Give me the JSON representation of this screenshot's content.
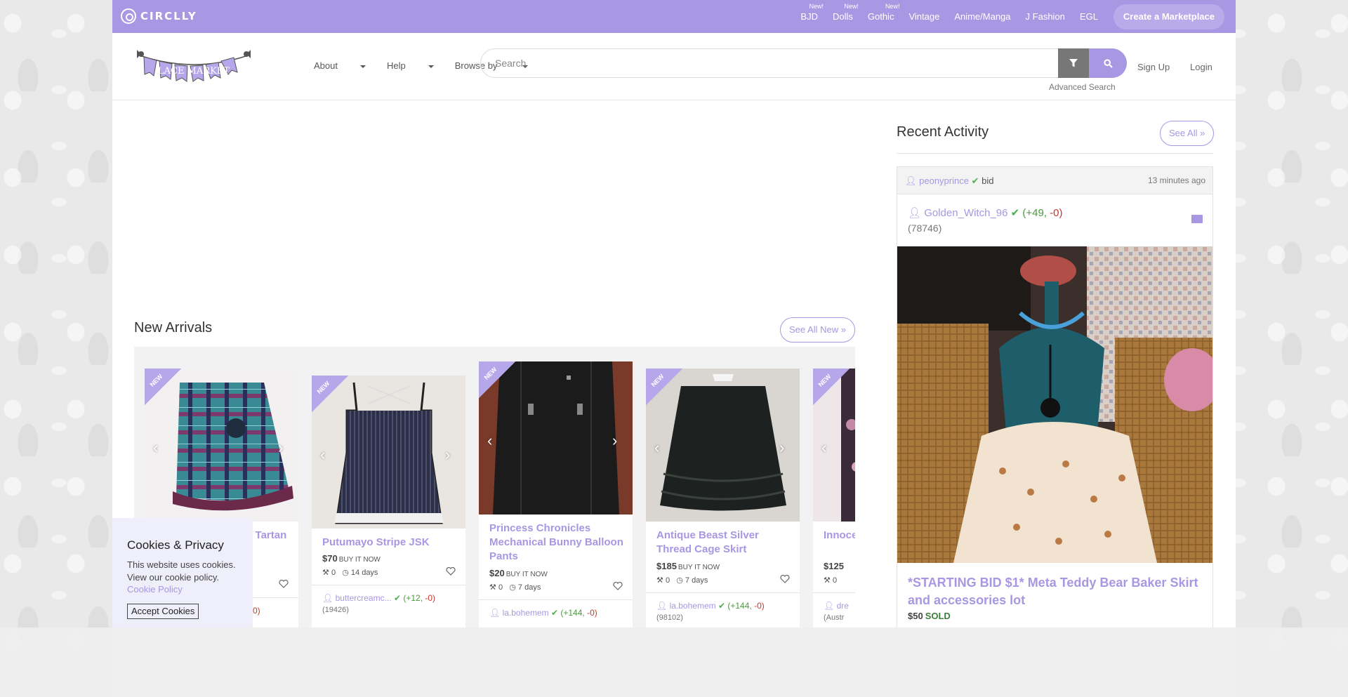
{
  "topbar": {
    "logo": "CIRCLLY",
    "items": [
      {
        "label": "BJD",
        "new": "New!"
      },
      {
        "label": "Dolls",
        "new": "New!"
      },
      {
        "label": "Gothic",
        "new": "New!"
      },
      {
        "label": "Vintage"
      },
      {
        "label": "Anime/Manga"
      },
      {
        "label": "J Fashion"
      },
      {
        "label": "EGL"
      }
    ],
    "cta": "Create a Marketplace"
  },
  "header": {
    "logo_text": "LACE MARKET",
    "nav": {
      "about": "About",
      "help": "Help",
      "browse": "Browse by"
    },
    "search_placeholder": "Search",
    "advanced": "Advanced Search",
    "signup": "Sign Up",
    "login": "Login"
  },
  "new_arrivals": {
    "title": "New Arrivals",
    "see_all": "See All New »",
    "badge": "NEW",
    "cards": [
      {
        "title": "Angelic Pretty Cute Tartan Bows",
        "price": "",
        "type": "",
        "bids": "",
        "time": "",
        "seller": "",
        "rep_pos": "",
        "rep_neg": "-0)",
        "zip": ""
      },
      {
        "title": "Putumayo Stripe JSK",
        "price": "$70",
        "type": "BUY IT NOW",
        "bids": "0",
        "time": "14 days",
        "seller": "buttercreamc...",
        "rep_pos": "(+12,",
        "rep_neg": "-0)",
        "zip": "(19426)"
      },
      {
        "title": "Princess Chronicles Mechanical Bunny Balloon Pants",
        "price": "$20",
        "type": "BUY IT NOW",
        "bids": "0",
        "time": "7 days",
        "seller": "la.bohemem",
        "rep_pos": "(+144,",
        "rep_neg": "-0)",
        "zip": ""
      },
      {
        "title": "Antique Beast Silver Thread Cage Skirt",
        "price": "$185",
        "type": "BUY IT NOW",
        "bids": "0",
        "time": "7 days",
        "seller": "la.bohemem",
        "rep_pos": "(+144,",
        "rep_neg": "-0)",
        "zip": "(98102)"
      },
      {
        "title": "Innocent World Rose",
        "price": "$125",
        "type": "",
        "bids": "0",
        "time": "",
        "seller": "dre",
        "rep_pos": "",
        "rep_neg": "",
        "zip": "(Austr"
      }
    ]
  },
  "recent_activity": {
    "title": "Recent Activity",
    "see_all": "See All »",
    "user": "peonyprince",
    "action": "bid",
    "time": "13 minutes ago",
    "seller": "Golden_Witch_96",
    "rep_pos": "(+49,",
    "rep_neg": "-0)",
    "zip": "(78746)",
    "item_title": "*STARTING BID $1* Meta Teddy Bear Baker Skirt and accessories lot",
    "price": "$50",
    "status": "SOLD"
  },
  "cookie": {
    "title": "Cookies & Privacy",
    "text": "This website uses cookies. View our cookie policy.",
    "link": "Cookie Policy",
    "accept": "Accept Cookies"
  }
}
